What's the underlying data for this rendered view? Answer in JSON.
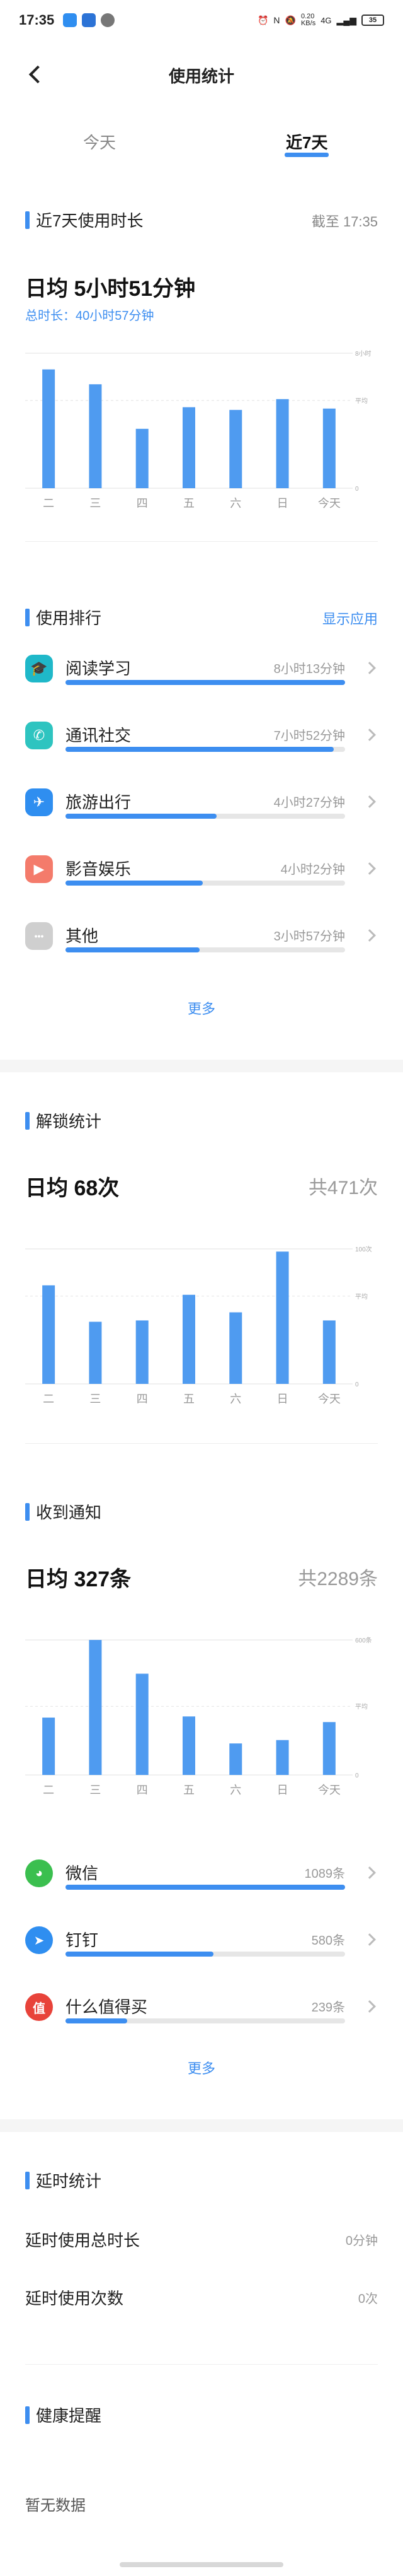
{
  "status_bar": {
    "time": "17:35",
    "speed": "0.20\nKB/s",
    "network": "4G",
    "battery": "35"
  },
  "header": {
    "title": "使用统计"
  },
  "tabs": [
    {
      "label": "今天",
      "active": false
    },
    {
      "label": "近7天",
      "active": true
    }
  ],
  "usage": {
    "title": "近7天使用时长",
    "cutoff": "截至 17:35",
    "avg": "日均 5小时51分钟",
    "total": "总时长：40小时57分钟",
    "avg_line_label": "平均",
    "top_line_label": "8小时",
    "zero_label": "0"
  },
  "ranking": {
    "title": "使用排行",
    "show_apps": "显示应用",
    "items": [
      {
        "name": "阅读学习",
        "value": "8小时13分钟",
        "fraction": 1.0,
        "icon": "graduation-cap-icon",
        "color": "#1fb8c9"
      },
      {
        "name": "通讯社交",
        "value": "7小时52分钟",
        "fraction": 0.96,
        "icon": "phone-icon",
        "color": "#2ec4c0"
      },
      {
        "name": "旅游出行",
        "value": "4小时27分钟",
        "fraction": 0.54,
        "icon": "airplane-icon",
        "color": "#2f8ef0"
      },
      {
        "name": "影音娱乐",
        "value": "4小时2分钟",
        "fraction": 0.49,
        "icon": "play-icon",
        "color": "#f47b6b"
      },
      {
        "name": "其他",
        "value": "3小时57分钟",
        "fraction": 0.48,
        "icon": "more-dots-icon",
        "color": "#cfcfcf"
      }
    ],
    "more": "更多"
  },
  "unlock": {
    "title": "解锁统计",
    "avg": "日均 68次",
    "total": "共471次",
    "top_line_label": "100次",
    "avg_line_label": "平均",
    "zero_label": "0"
  },
  "notify": {
    "title": "收到通知",
    "avg": "日均 327条",
    "total": "共2289条",
    "top_line_label": "600条",
    "avg_line_label": "平均",
    "zero_label": "0",
    "items": [
      {
        "name": "微信",
        "value": "1089条",
        "fraction": 1.0,
        "icon": "wechat-icon",
        "color": "#3bbf4f"
      },
      {
        "name": "钉钉",
        "value": "580条",
        "fraction": 0.53,
        "icon": "dingtalk-icon",
        "color": "#2f8ef0"
      },
      {
        "name": "什么值得买",
        "value": "239条",
        "fraction": 0.22,
        "icon": "smzdm-icon",
        "color": "#e8433a"
      }
    ],
    "more": "更多"
  },
  "delay": {
    "title": "延时统计",
    "rows": [
      {
        "label": "延时使用总时长",
        "value": "0分钟"
      },
      {
        "label": "延时使用次数",
        "value": "0次"
      }
    ]
  },
  "health": {
    "title": "健康提醒",
    "empty": "暂无数据"
  },
  "chart_data": [
    {
      "type": "bar",
      "title": "近7天使用时长",
      "categories": [
        "二",
        "三",
        "四",
        "五",
        "六",
        "日",
        "今天"
      ],
      "values": [
        8.8,
        7.7,
        4.4,
        6.0,
        5.8,
        6.6,
        5.9
      ],
      "unit": "hours",
      "ylim": [
        0,
        10
      ],
      "reference_lines": [
        {
          "label": "8小时",
          "value": 10
        },
        {
          "label": "平均",
          "value": 6.5
        }
      ],
      "color": "#4f9bf0"
    },
    {
      "type": "bar",
      "title": "解锁统计",
      "categories": [
        "二",
        "三",
        "四",
        "五",
        "六",
        "日",
        "今天"
      ],
      "values": [
        73,
        46,
        47,
        66,
        53,
        98,
        47
      ],
      "ylim": [
        0,
        100
      ],
      "reference_lines": [
        {
          "label": "100次",
          "value": 100
        },
        {
          "label": "平均",
          "value": 65
        }
      ],
      "color": "#4f9bf0"
    },
    {
      "type": "bar",
      "title": "收到通知",
      "categories": [
        "二",
        "三",
        "四",
        "五",
        "六",
        "日",
        "今天"
      ],
      "values": [
        255,
        600,
        450,
        260,
        140,
        155,
        235
      ],
      "ylim": [
        0,
        600
      ],
      "reference_lines": [
        {
          "label": "600条",
          "value": 600
        },
        {
          "label": "平均",
          "value": 305
        }
      ],
      "color": "#4f9bf0"
    }
  ]
}
